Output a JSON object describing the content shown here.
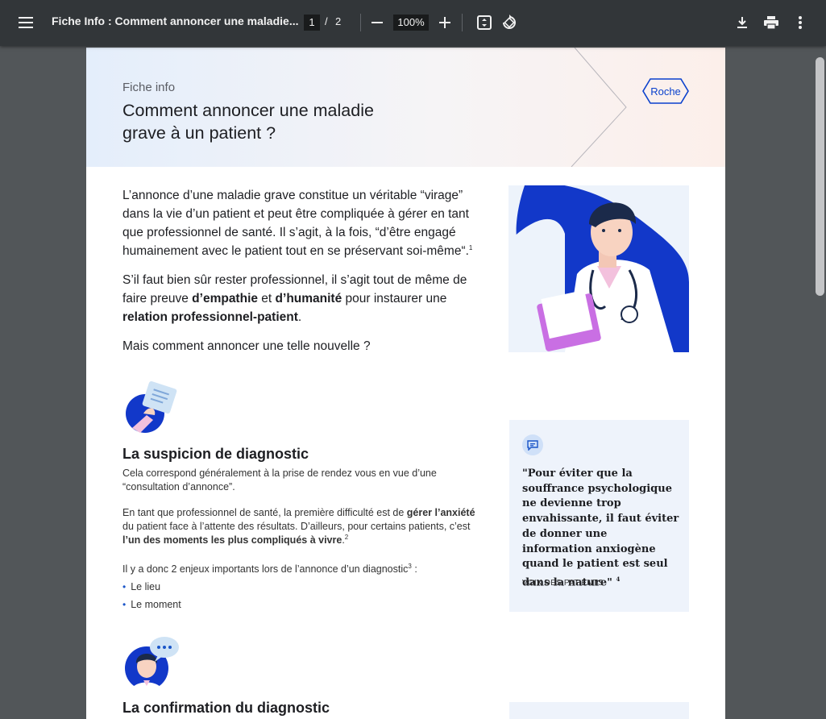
{
  "toolbar": {
    "title": "Fiche Info : Comment annoncer une maladie...",
    "current_page": "1",
    "page_separator": "/",
    "total_pages": "2",
    "zoom": "100%",
    "icons": [
      "menu-icon",
      "zoom-out-icon",
      "zoom-in-icon",
      "fit-page-icon",
      "rotate-icon",
      "download-icon",
      "print-icon",
      "more-options-icon"
    ]
  },
  "document": {
    "header": {
      "label": "Fiche info",
      "title": "Comment annoncer une maladie grave à un patient ?",
      "logo": "Roche"
    },
    "intro": {
      "p1": "L’annonce d’une maladie grave constitue un véritable “virage” dans la vie d’un patient et peut être compliquée à gérer en tant que professionnel de santé. Il s’agit, à la fois, “d’être engagé humainement avec le patient tout en se préservant soi-même“.",
      "p1_ref": "1",
      "p2_a": "S’il faut bien sûr rester professionnel, il s’agit tout de même de faire preuve ",
      "p2_b": "d’empathie",
      "p2_c": " et ",
      "p2_d": "d’humanité",
      "p2_e": " pour instaurer une ",
      "p2_f": "relation professionnel-patient",
      "p2_g": ".",
      "p3": "Mais comment annoncer une telle nouvelle ?"
    },
    "section1": {
      "heading": "La suspicion de diagnostic",
      "p1": "Cela correspond généralement à la prise de rendez vous en vue d’une “consultation d’annonce”.",
      "p2_a": "En tant que professionnel de santé, la première difficulté est de ",
      "p2_b": "gérer l’anxiété",
      "p2_c": " du patient face à l’attente des résultats. D’ailleurs, pour certains patients, c’est ",
      "p2_d": "l’un des moments les plus compliqués à vivre",
      "p2_e": ".",
      "p2_ref": "2",
      "p3": "Il y a donc 2 enjeux importants lors de l’annonce d’un diagnostic",
      "p3_ref": "3",
      "p3_end": " :",
      "bullets": [
        "Le lieu",
        "Le moment"
      ]
    },
    "quote": {
      "text": "\"Pour éviter que la souffrance psychologique ne devienne trop envahissante, il faut éviter de donner une information anxiogène quand le patient est seul dans la nature\"",
      "ref": "4",
      "source": "VOIX DES PATIENTS"
    },
    "section2": {
      "heading": "La confirmation du diagnostic"
    },
    "colors": {
      "toolbar": "#323639",
      "viewer_bg": "#525659",
      "accent_blue": "#1a55c8",
      "card_bg": "#eef3fb"
    }
  }
}
